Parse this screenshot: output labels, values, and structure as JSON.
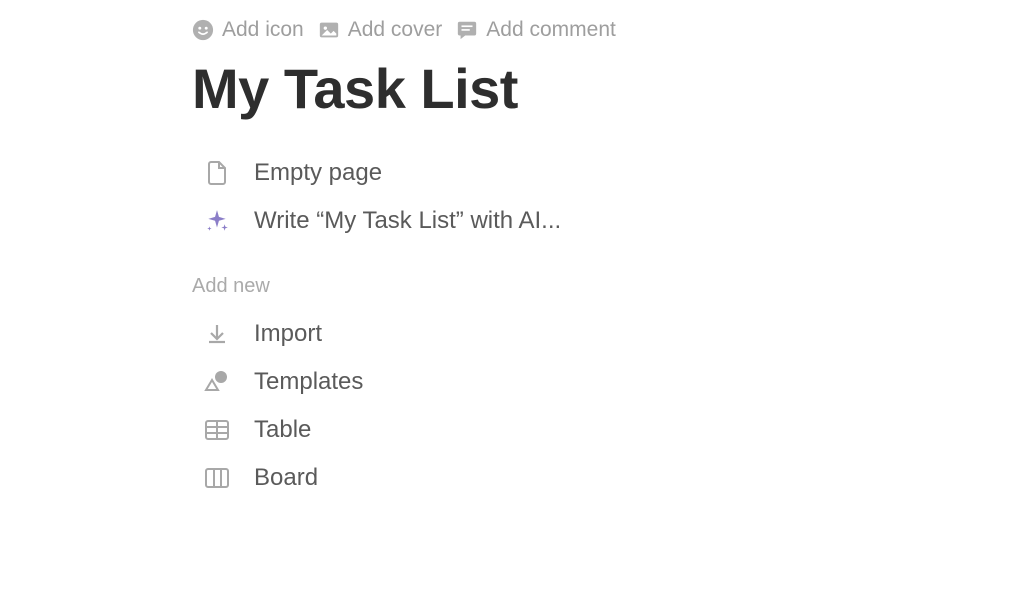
{
  "toolbar": {
    "add_icon": "Add icon",
    "add_cover": "Add cover",
    "add_comment": "Add comment"
  },
  "page_title": "My Task List",
  "quick_options": {
    "empty_page": "Empty page",
    "write_with_ai": "Write “My Task List” with AI..."
  },
  "section_label": "Add new",
  "add_new_items": {
    "import": "Import",
    "templates": "Templates",
    "table": "Table",
    "board": "Board"
  }
}
